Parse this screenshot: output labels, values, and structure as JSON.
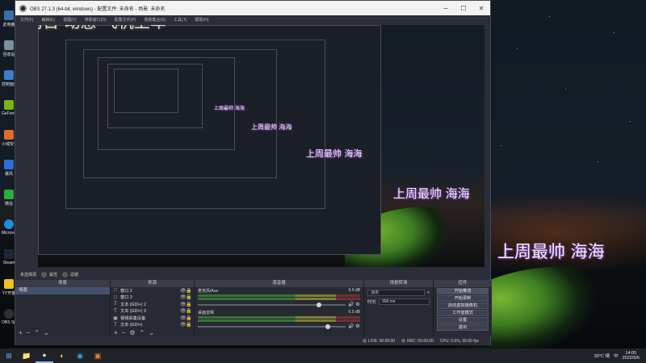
{
  "window": {
    "title": "OBS 27.1.3 (64-bit, windows) - 配置文件: 未命名 - 场景: 未命名",
    "minimize": "─",
    "maximize": "☐",
    "close": "✕"
  },
  "menu": [
    "文件(F)",
    "编辑(E)",
    "视图(V)",
    "停靠窗口(D)",
    "配置文件(P)",
    "场景集合(S)",
    "工具(T)",
    "帮助(H)"
  ],
  "overlay": {
    "top_text": "周日 动感 飞机上车",
    "caption": "上周最帅 海海"
  },
  "mini_toolbar": {
    "no_source": "未选择源",
    "properties": "属性",
    "filters": "滤镜"
  },
  "docks": {
    "scenes": {
      "title": "场景",
      "items": [
        "场景"
      ]
    },
    "sources": {
      "title": "来源",
      "items": [
        {
          "icon": "□",
          "name": "窗口 2"
        },
        {
          "icon": "□",
          "name": "窗口 3"
        },
        {
          "icon": "T",
          "name": "文本 (GDI+) 2"
        },
        {
          "icon": "T",
          "name": "文本 (GDI+) 3"
        },
        {
          "icon": "▣",
          "name": "视频采集设备"
        },
        {
          "icon": "T",
          "name": "文本 (GDI+)"
        }
      ]
    },
    "mixer": {
      "title": "混音器",
      "tracks": [
        {
          "name": "麦克风/Aux",
          "db": "0.0 dB",
          "level": 0.82
        },
        {
          "name": "桌面音频",
          "db": "0.0 dB",
          "level": 0.88
        }
      ]
    },
    "transitions": {
      "title": "场景转场",
      "type": "淡出",
      "duration_label": "时长",
      "duration_value": "300 ms"
    },
    "controls": {
      "title": "控件",
      "buttons": [
        "开始推流",
        "开始录制",
        "启动虚拟摄像机",
        "工作室模式",
        "设置",
        "退出"
      ]
    }
  },
  "statusbar": {
    "live": "LIVE: 00:00:00",
    "rec": "REC: 00:00:00",
    "cpu": "CPU: 0.5%, 30.00 fps"
  },
  "desktop_icons": [
    "此电脑",
    "回收站",
    "控制面板",
    "GeForce Experience",
    "火绒安全",
    "暴风",
    "微信",
    "Microsoft Edge",
    "Steam",
    "YY开播",
    "OBS Studio"
  ],
  "taskbar": {
    "apps": [
      "⊞",
      "📁",
      "●",
      "◐",
      "◉",
      "▣"
    ],
    "weather": "30°C 晴",
    "ime": "中",
    "time": "14:05",
    "date": "2022/5/6"
  }
}
